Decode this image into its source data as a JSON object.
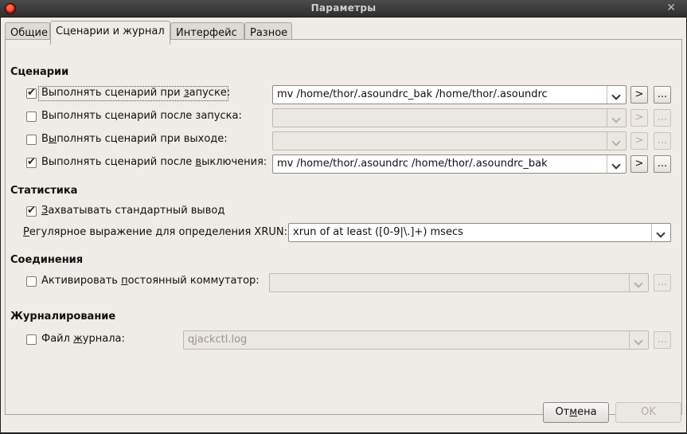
{
  "window": {
    "title": "Параметры",
    "close_glyph": "✕"
  },
  "tabs": [
    {
      "label": "Общие"
    },
    {
      "label": "Сценарии и журнал"
    },
    {
      "label": "Интерфейс"
    },
    {
      "label": "Разное"
    }
  ],
  "scripts": {
    "title": "Сценарии",
    "rows": [
      {
        "label_pre": "Выполнять сценарий при ",
        "label_u": "з",
        "label_post": "апуске:",
        "checked": true,
        "value": "mv /home/thor/.asoundrc_bak /home/thor/.asoundrc",
        "enabled": true
      },
      {
        "label_pre": "Выполнять сценарий после запуска:",
        "label_u": "",
        "label_post": "",
        "checked": false,
        "value": "",
        "enabled": false
      },
      {
        "label_pre": "В",
        "label_u": "ы",
        "label_post": "полнять сценарий при выходе:",
        "checked": false,
        "value": "",
        "enabled": false
      },
      {
        "label_pre": "Выполнять сценарий после ",
        "label_u": "в",
        "label_post": "ыключения:",
        "checked": true,
        "value": "mv /home/thor/.asoundrc /home/thor/.asoundrc_bak",
        "enabled": true
      }
    ],
    "symbol_button": ">",
    "browse_button": "..."
  },
  "statistics": {
    "title": "Статистика",
    "capture_pre": "",
    "capture_u": "З",
    "capture_post": "ахватывать стандартный вывод",
    "capture_checked": true,
    "xrun_pre": "",
    "xrun_u": "Р",
    "xrun_post": "егулярное выражение для определения XRUN:",
    "xrun_value": "xrun of at least ([0-9|\\.]+) msecs"
  },
  "connections": {
    "title": "Соединения",
    "patchbay_pre": "Активировать ",
    "patchbay_u": "п",
    "patchbay_post": "остоянный коммутатор:",
    "patchbay_checked": false,
    "patchbay_value": ""
  },
  "logging": {
    "title": "Журналирование",
    "logfile_pre": "Файл ",
    "logfile_u": "ж",
    "logfile_post": "урнала:",
    "logfile_checked": false,
    "logfile_value": "qjackctl.log"
  },
  "buttons": {
    "cancel_pre": "От",
    "cancel_u": "м",
    "cancel_post": "ена",
    "ok": "OK"
  }
}
